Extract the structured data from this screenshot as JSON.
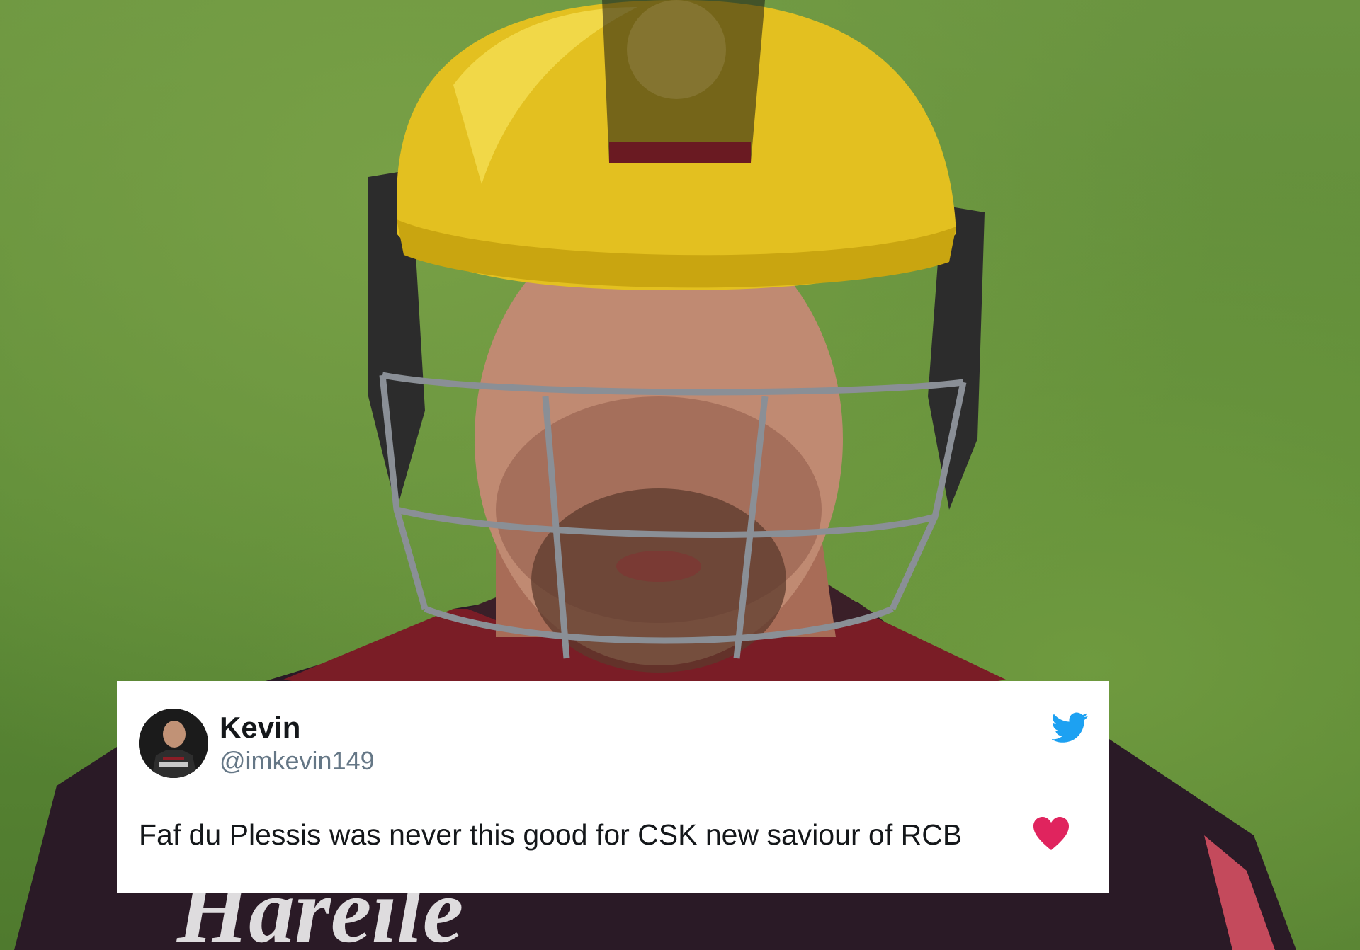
{
  "tweet": {
    "display_name": "Kevin",
    "handle": "@imkevin149",
    "text": "Faf du Plessis was never this good for CSK new saviour of RCB",
    "emoji_icon": "red-heart-icon",
    "brand_icon": "twitter-bird-icon"
  },
  "colors": {
    "field_green": "#5f8a3a",
    "helmet_gold": "#e3c020",
    "jersey_maroon": "#7a1d26",
    "twitter_blue": "#1da1f2",
    "heart_red": "#e0245e",
    "name_text": "#14171a",
    "handle_text": "#657786"
  }
}
